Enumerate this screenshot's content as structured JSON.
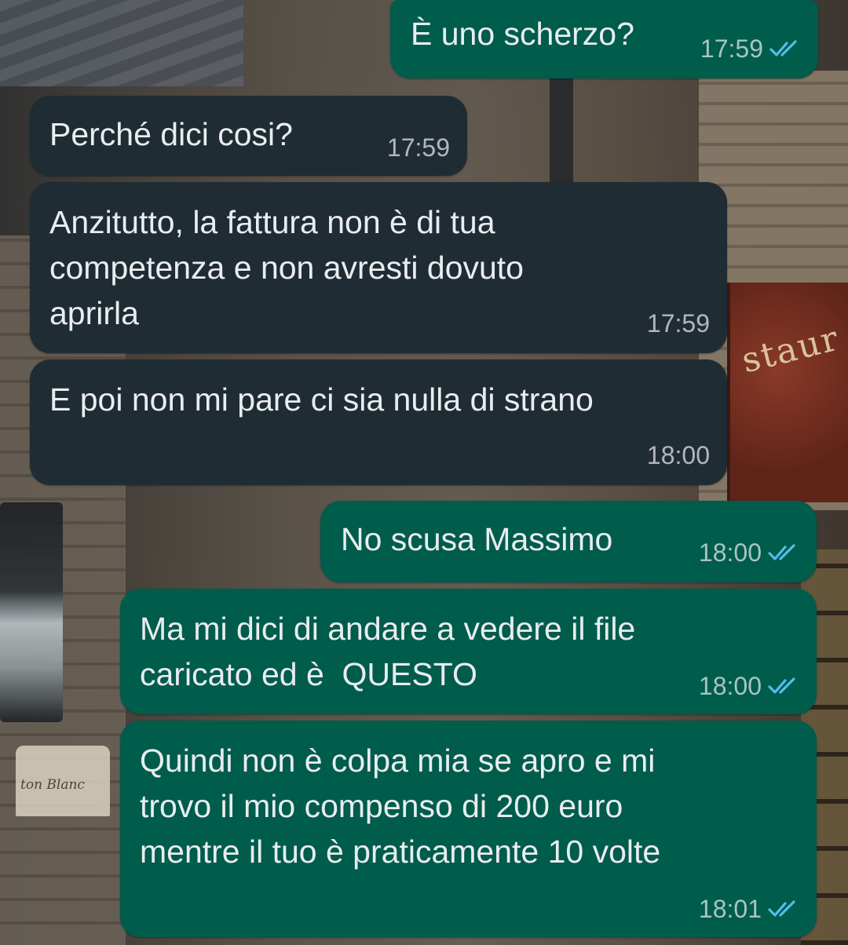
{
  "theme": {
    "outgoing_bubble": "#005c4b",
    "incoming_bubble": "#202c33",
    "text": "#e9edef",
    "read_ticks": "#53bdeb"
  },
  "wallpaper": {
    "sign_text": "staur",
    "plaque_text": "ton Blanc"
  },
  "messages": [
    {
      "direction": "out",
      "text": "È uno scherzo?",
      "time": "17:59",
      "status_icon": "double-check-read-icon"
    },
    {
      "direction": "in",
      "text": "Perché dici cosi?",
      "time": "17:59"
    },
    {
      "direction": "in",
      "text": "Anzitutto, la fattura non è di tua\ncompetenza e non avresti dovuto\naprirla",
      "time": "17:59"
    },
    {
      "direction": "in",
      "text": "E poi non mi pare ci sia nulla di strano",
      "time": "18:00"
    },
    {
      "direction": "out",
      "text": "No scusa Massimo",
      "time": "18:00",
      "status_icon": "double-check-read-icon"
    },
    {
      "direction": "out",
      "text": "Ma mi dici di andare a vedere il file\ncaricato ed è  QUESTO",
      "time": "18:00",
      "status_icon": "double-check-read-icon"
    },
    {
      "direction": "out",
      "text": "Quindi non è colpa mia se apro e mi\ntrovo il mio compenso di 200 euro\nmentre il tuo è praticamente 10 volte",
      "time": "18:01",
      "status_icon": "double-check-read-icon"
    }
  ]
}
